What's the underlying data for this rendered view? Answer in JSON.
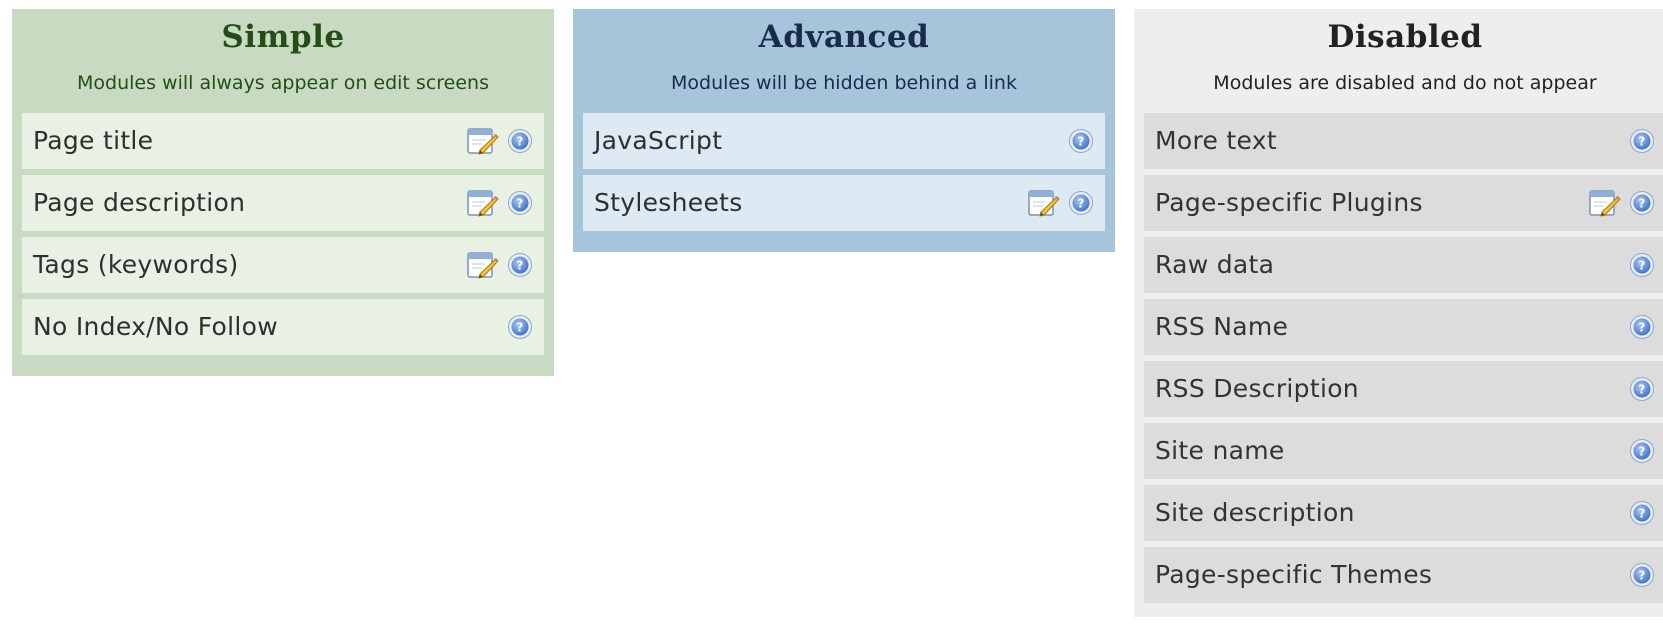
{
  "columns": [
    {
      "id": "simple",
      "title": "Simple",
      "description": "Modules will always appear on edit screens",
      "modules": [
        {
          "label": "Page title",
          "editable": true
        },
        {
          "label": "Page description",
          "editable": true
        },
        {
          "label": "Tags (keywords)",
          "editable": true
        },
        {
          "label": "No Index/No Follow",
          "editable": false
        }
      ]
    },
    {
      "id": "advanced",
      "title": "Advanced",
      "description": "Modules will be hidden behind a link",
      "modules": [
        {
          "label": "JavaScript",
          "editable": false
        },
        {
          "label": "Stylesheets",
          "editable": true
        }
      ]
    },
    {
      "id": "disabled",
      "title": "Disabled",
      "description": "Modules are disabled and do not appear",
      "modules": [
        {
          "label": "More text",
          "editable": false
        },
        {
          "label": "Page-specific Plugins",
          "editable": true
        },
        {
          "label": "Raw data",
          "editable": false
        },
        {
          "label": "RSS Name",
          "editable": false
        },
        {
          "label": "RSS Description",
          "editable": false
        },
        {
          "label": "Site name",
          "editable": false
        },
        {
          "label": "Site description",
          "editable": false
        },
        {
          "label": "Page-specific Themes",
          "editable": false
        }
      ]
    }
  ],
  "icons": {
    "edit": "edit-icon",
    "help": "help-icon"
  },
  "colors": {
    "simple_bg": "#c8dbc2",
    "advanced_bg": "#a6c4da",
    "disabled_bg": "#eeeeee"
  }
}
